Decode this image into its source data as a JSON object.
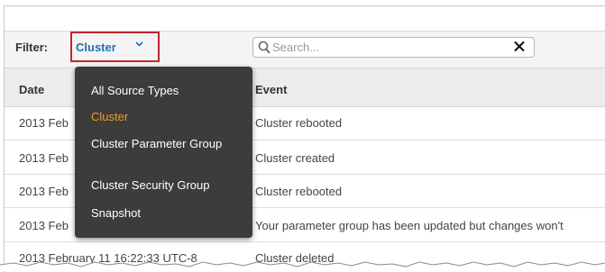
{
  "filter": {
    "label": "Filter:",
    "selected": "Cluster",
    "options": [
      "All Source Types",
      "Cluster",
      "Cluster Parameter Group",
      "Cluster Security Group",
      "Snapshot"
    ]
  },
  "search": {
    "placeholder": "Search...",
    "value": ""
  },
  "table": {
    "columns": [
      "Date",
      "Event"
    ],
    "rows": [
      {
        "date": "2013 Feb",
        "event": "Cluster rebooted"
      },
      {
        "date": "2013 Feb",
        "event": "Cluster created"
      },
      {
        "date": "2013 Feb",
        "event": "Cluster rebooted"
      },
      {
        "date": "2013 Feb",
        "event": "Your parameter group has been updated but changes won't"
      },
      {
        "date": "2013 February 11 16:22:33 UTC-8",
        "event": "Cluster deleted"
      }
    ]
  },
  "colors": {
    "highlight_border": "#c0262e",
    "link_blue": "#1f6fb5",
    "active_option": "#f59a1f",
    "dropdown_bg": "#3c3c3c"
  },
  "icons": {
    "filter_chevron": "chevron-down-icon",
    "search": "search-icon",
    "clear": "close-icon"
  }
}
